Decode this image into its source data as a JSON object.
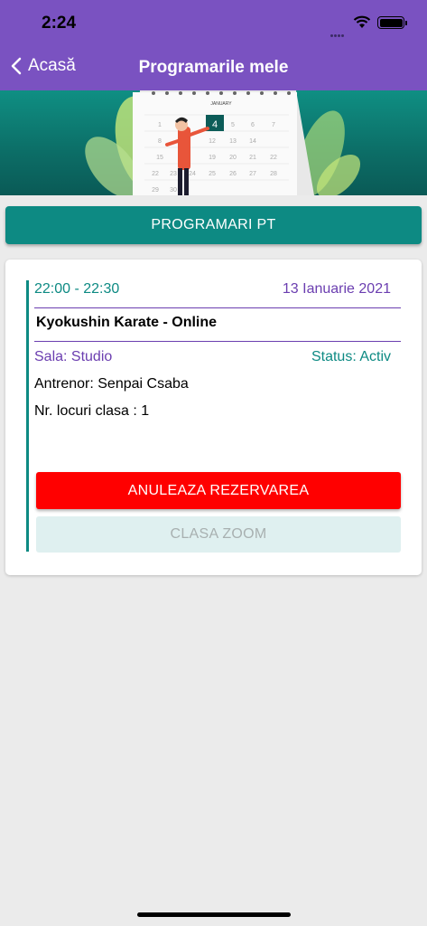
{
  "statusbar": {
    "time": "2:24"
  },
  "navbar": {
    "back_label": "Acasă",
    "title": "Programarile mele"
  },
  "banner": {
    "calendar_month": "JANUARY",
    "highlighted_day": "4"
  },
  "pt_button": {
    "label": "PROGRAMARI PT"
  },
  "booking": {
    "time_range": "22:00 - 22:30",
    "date": "13 Ianuarie 2021",
    "class_name": "Kyokushin Karate - Online",
    "room": "Sala: Studio",
    "status": "Status: Activ",
    "trainer": "Antrenor: Senpai Csaba",
    "spots": "Nr. locuri clasa : 1",
    "cancel_label": "ANULEAZA REZERVAREA",
    "zoom_label": "CLASA ZOOM"
  },
  "colors": {
    "header_purple": "#7a52c1",
    "teal": "#0d8a83",
    "purple_text": "#6b3eb0",
    "cancel_red": "#ff0000",
    "disabled_bg": "#dff0f0"
  }
}
